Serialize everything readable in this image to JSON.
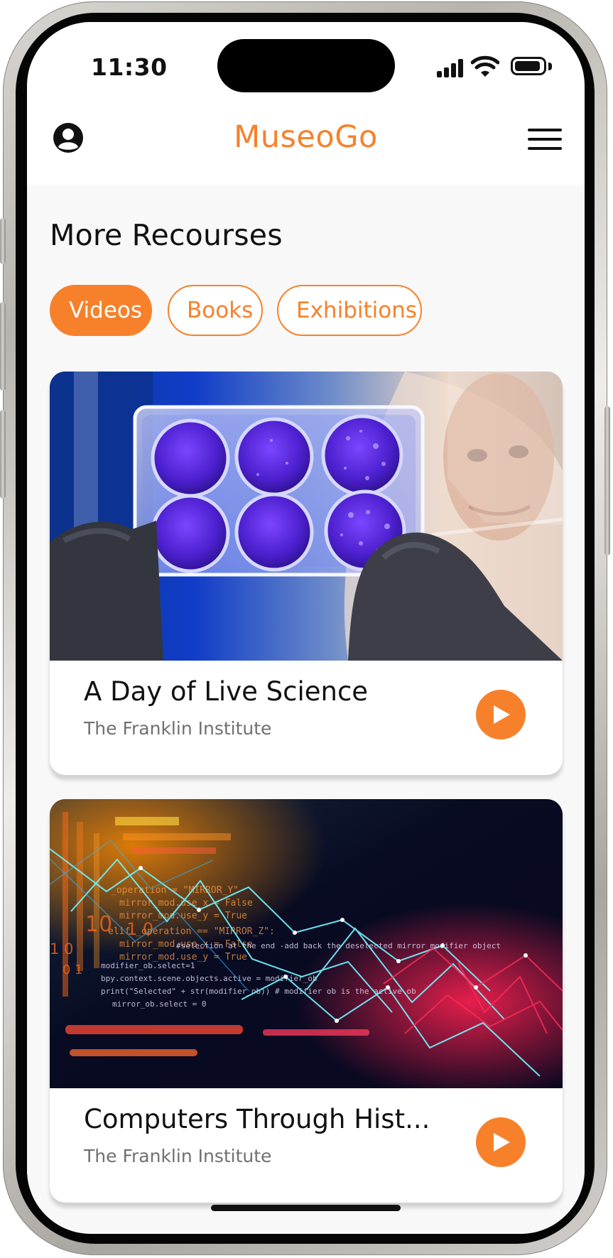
{
  "status_bar": {
    "time": "11:30",
    "icons": [
      "signal-icon",
      "wifi-icon",
      "battery-icon"
    ]
  },
  "header": {
    "app_name": "MuseoGo",
    "icons": {
      "profile": "user-circle-icon",
      "menu": "hamburger-menu-icon"
    }
  },
  "section": {
    "title": "More Recourses"
  },
  "filters": [
    {
      "label": "Videos",
      "active": true
    },
    {
      "label": "Books",
      "active": false
    },
    {
      "label": "Exhibitions",
      "active": false
    }
  ],
  "videos": [
    {
      "title": "A Day of Live Science",
      "source": "The Franklin Institute",
      "image": "scientist holding purple petri dish plate"
    },
    {
      "title": "Computers Through Hist...",
      "source": "The Franklin Institute",
      "image": "colorful code screen with network graphics"
    }
  ],
  "colors": {
    "accent": "#F7812B",
    "text": "#111111",
    "secondary_text": "#707070",
    "background": "#F8F8F8",
    "card": "#FFFFFF"
  }
}
